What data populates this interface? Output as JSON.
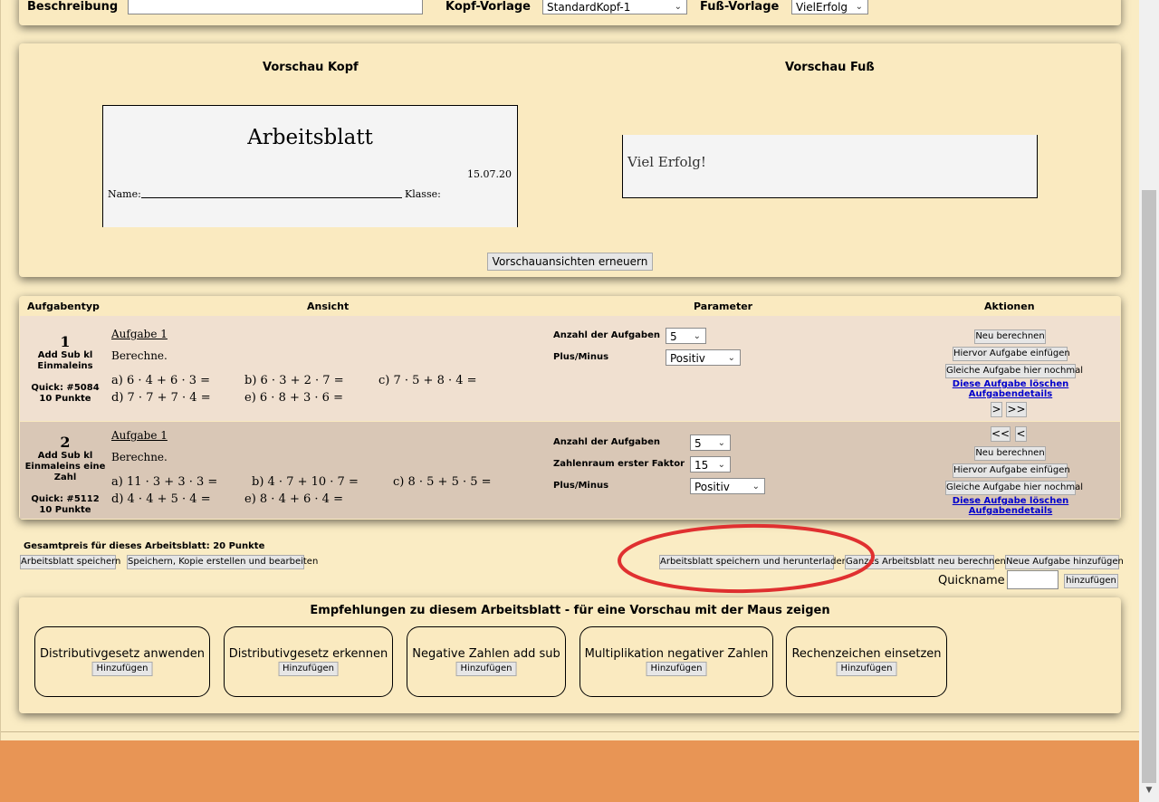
{
  "header": {
    "beschreibung_label": "Beschreibung",
    "beschreibung_value": "",
    "kopf_label": "Kopf-Vorlage",
    "kopf_value": "StandardKopf-1",
    "fuss_label": "Fuß-Vorlage",
    "fuss_value": "VielErfolg"
  },
  "preview": {
    "kopf_title": "Vorschau Kopf",
    "fuss_title": "Vorschau Fuß",
    "kopf_heading": "Arbeitsblatt",
    "kopf_date": "15.07.20",
    "kopf_name": "Name:",
    "kopf_klasse": "Klasse:",
    "fuss_text": "Viel Erfolg!",
    "refresh_button": "Vorschauansichten erneuern"
  },
  "table": {
    "headers": [
      "Aufgabentyp",
      "Ansicht",
      "Parameter",
      "Aktionen"
    ],
    "rows": [
      {
        "number": "1",
        "type": "Add Sub kl Einmaleins",
        "quick": "Quick: #5084",
        "points": "10 Punkte",
        "aufgabe": "Aufgabe 1",
        "instruction": "Berechne.",
        "exercises": [
          "a) 6 · 4 + 6 · 3 =",
          "b) 6 · 3 + 2 · 7 =",
          "c) 7 · 5 + 8 · 4 =",
          "d) 7 · 7 + 7 · 4 =",
          "e) 6 · 8 + 3 · 6 ="
        ],
        "params": [
          {
            "label": "Anzahl der Aufgaben",
            "value": "5"
          },
          {
            "label": "Plus/Minus",
            "value": "Positiv"
          }
        ],
        "actions": {
          "neu": "Neu berechnen",
          "hiervor": "Hiervor Aufgabe einfügen",
          "gleiche": "Gleiche Aufgabe hier nochmal",
          "loeschen": "Diese Aufgabe löschen",
          "details": "Aufgabendetails",
          "next": ">",
          "last": ">>"
        }
      },
      {
        "number": "2",
        "type": "Add Sub kl Einmaleins eine Zahl",
        "quick": "Quick: #5112",
        "points": "10 Punkte",
        "aufgabe": "Aufgabe 1",
        "instruction": "Berechne.",
        "exercises": [
          "a) 11 · 3 + 3 · 3 =",
          "b) 4 · 7 + 10 · 7 =",
          "c) 8 · 5 + 5 · 5 =",
          "d) 4 · 4 + 5 · 4 =",
          "e) 8 · 4 + 6 · 4 ="
        ],
        "params": [
          {
            "label": "Anzahl der Aufgaben",
            "value": "5"
          },
          {
            "label": "Zahlenraum erster Faktor",
            "value": "15"
          },
          {
            "label": "Plus/Minus",
            "value": "Positiv"
          }
        ],
        "actions": {
          "first": "<<",
          "prev": "<",
          "neu": "Neu berechnen",
          "hiervor": "Hiervor Aufgabe einfügen",
          "gleiche": "Gleiche Aufgabe hier nochmal",
          "loeschen": "Diese Aufgabe löschen",
          "details": "Aufgabendetails"
        }
      }
    ]
  },
  "footer": {
    "gesamtpreis": "Gesamtpreis für dieses Arbeitsblatt: 20 Punkte",
    "speichern": "Arbeitsblatt speichern",
    "kopie": "Speichern, Kopie erstellen und bearbeiten",
    "download": "Arbeitsblatt speichern und herunterladen",
    "neu_berechnen": "Ganzes Arbeitsblatt neu berechnen",
    "neue_aufgabe": "Neue Aufgabe hinzufügen",
    "quickname_label": "Quickname",
    "quickname_value": "",
    "hinzufuegen": "hinzufügen"
  },
  "recommendations": {
    "title": "Empfehlungen zu diesem Arbeitsblatt - für eine Vorschau mit der Maus zeigen",
    "items": [
      {
        "label": "Distributivgesetz anwenden",
        "button": "Hinzufügen"
      },
      {
        "label": "Distributivgesetz erkennen",
        "button": "Hinzufügen"
      },
      {
        "label": "Negative Zahlen add sub",
        "button": "Hinzufügen"
      },
      {
        "label": "Multiplikation negativer Zahlen",
        "button": "Hinzufügen"
      },
      {
        "label": "Rechenzeichen einsetzen",
        "button": "Hinzufügen"
      }
    ]
  },
  "colors": {
    "page_bg": "#faecc4",
    "row1_bg": "#f0e0d0",
    "row2_bg": "#d9c7b6",
    "bottom_bar": "#e89555",
    "highlight_ring": "#e03030"
  }
}
